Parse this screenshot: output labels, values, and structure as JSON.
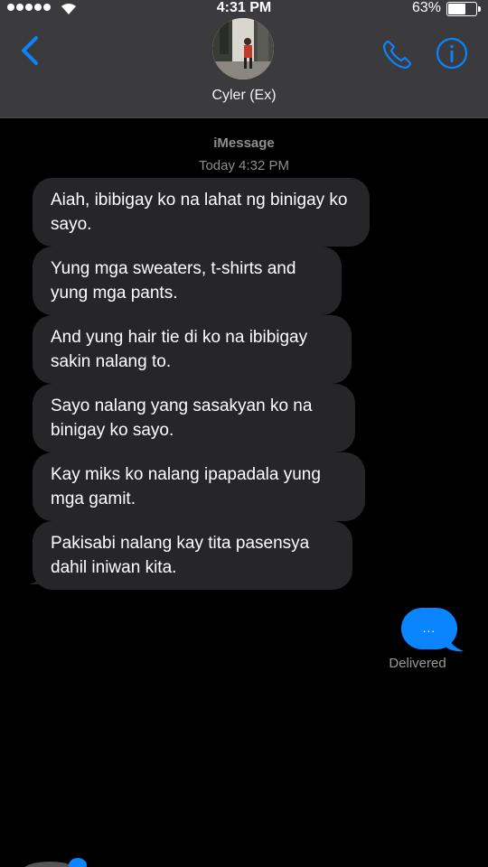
{
  "status_bar": {
    "time": "4:31 PM",
    "battery_percent": "63%",
    "battery_level": 0.63,
    "signal_bars": 5
  },
  "header": {
    "contact_name": "Cyler (Ex)",
    "icons": [
      "back-chevron-icon",
      "phone-icon",
      "info-icon"
    ],
    "accent_color": "#0a84ff"
  },
  "conversation": {
    "service": "iMessage",
    "timestamp": "Today 4:32 PM",
    "received_messages": [
      {
        "text": "Aiah, ibibigay ko na lahat ng binigay ko sayo."
      },
      {
        "text": "Yung mga sweaters, t-shirts and yung mga pants."
      },
      {
        "text": "And yung hair tie di ko na ibibigay sakin nalang to."
      },
      {
        "text": "Sayo nalang yang sasakyan ko na binigay ko sayo."
      },
      {
        "text": "Kay miks ko nalang ipapadala yung mga gamit."
      },
      {
        "text": "Pakisabi nalang kay tita pasensya dahil iniwan kita."
      }
    ],
    "sent_message": {
      "text": "...",
      "status": "Delivered"
    }
  },
  "colors": {
    "header_bg": "#3b3b3d",
    "received_bubble": "#262628",
    "sent_bubble": "#0b84ff",
    "meta_text": "#8e8e93"
  }
}
